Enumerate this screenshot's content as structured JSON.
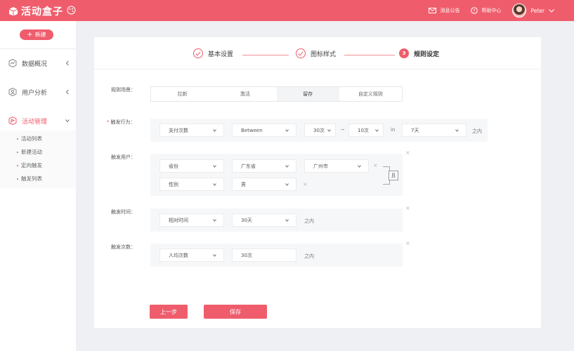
{
  "header": {
    "logo_text": "活动盒子",
    "messages_label": "消息公告",
    "help_label": "帮助中心",
    "username": "Peter"
  },
  "sidebar": {
    "new_button": "新建",
    "menu": [
      {
        "label": "数据概况",
        "icon": "chart-icon"
      },
      {
        "label": "用户分析",
        "icon": "user-icon"
      },
      {
        "label": "活动管理",
        "icon": "activity-icon"
      }
    ],
    "submenu": [
      "活动列表",
      "新建活动",
      "定向触发",
      "触发列表"
    ]
  },
  "steps": [
    {
      "label": "基本设置",
      "state": "done"
    },
    {
      "label": "图标样式",
      "state": "done"
    },
    {
      "label": "规则设定",
      "state": "current",
      "number": "3"
    }
  ],
  "form": {
    "scenario_label": "规则场景：",
    "scenario_tabs": [
      "拉新",
      "激活",
      "留存",
      "自定义规则"
    ],
    "scenario_active": "留存",
    "behavior_label": "触发行为：",
    "behavior": {
      "type": "支付次数",
      "operator": "Between",
      "from": "30次",
      "dash": "~",
      "to": "10次",
      "in": "in",
      "period": "7天",
      "suffix": "之内"
    },
    "users_label": "触发用户：",
    "users": {
      "row1_attr": "省份",
      "row1_value": "广东省",
      "row1_city": "广州市",
      "row2_attr": "性别",
      "row2_value": "男",
      "and_label": "且"
    },
    "time_label": "触发时间：",
    "time": {
      "type": "相对时间",
      "value": "30天",
      "suffix": "之内"
    },
    "count_label": "触发次数：",
    "count": {
      "type": "人均次数",
      "value": "30次",
      "suffix": "之内"
    },
    "close_glyph": "×"
  },
  "actions": {
    "prev": "上一步",
    "save": "保存"
  },
  "colors": {
    "accent": "#ef5d6c"
  }
}
